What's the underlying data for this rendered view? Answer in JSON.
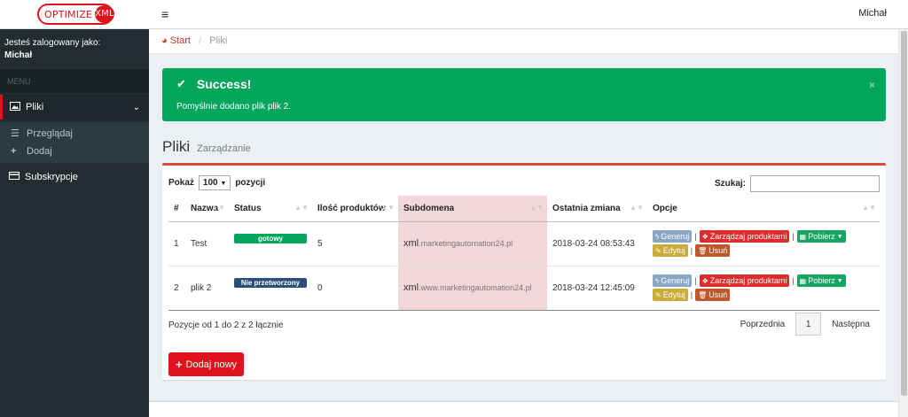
{
  "brand": {
    "part1": "OPTIMIZE",
    "part2": "XML"
  },
  "topbar": {
    "user": "Michał"
  },
  "sidebar": {
    "logged_label": "Jesteś zalogowany jako:",
    "logged_user": "Michał",
    "menu_header": "MENU",
    "files": "Pliki",
    "browse": "Przeglądaj",
    "add": "Dodaj",
    "subscriptions": "Subskrypcje"
  },
  "breadcrumb": {
    "home": "Start",
    "separator": "/",
    "current": "Pliki"
  },
  "alert": {
    "title": "Success!",
    "message": "Pomyślnie dodano plik plik 2.",
    "close": "×"
  },
  "page": {
    "title": "Pliki",
    "subtitle": "Zarządzanie"
  },
  "table_controls": {
    "show_label": "Pokaż",
    "show_value": "100",
    "show_suffix": "pozycji",
    "search_label": "Szukaj:",
    "search_value": ""
  },
  "table": {
    "headers": [
      "#",
      "Nazwa",
      "Status",
      "Ilość produktów",
      "Subdomena",
      "Ostatnia zmiana",
      "Opcje"
    ],
    "rows": [
      {
        "id": "1",
        "name": "Test",
        "status": "gotowy",
        "products": "5",
        "xml": "xml",
        "domain": ".marketingautomation24.pl",
        "changed": "2018-03-24 08:53:43"
      },
      {
        "id": "2",
        "name": "plik 2",
        "status": "Nie przetworzony",
        "products": "0",
        "xml": "xml",
        "domain": ".www.marketingautomation24.pl",
        "changed": "2018-03-24 12:45:09"
      }
    ],
    "actions": {
      "generate": "Generuj",
      "manage": "Zarządzaj produktami",
      "download": "Pobierz",
      "edit": "Edytuj",
      "delete": "Usuń",
      "separator": "|"
    }
  },
  "pagination": {
    "info": "Pozycje od 1 do 2 z 2 łącznie",
    "prev": "Poprzednia",
    "page": "1",
    "next": "Następna"
  },
  "add_button": "Dodaj nowy",
  "colors": {
    "brand_red": "#e0131c",
    "success": "#00a65a",
    "sidebar": "#222d32"
  }
}
